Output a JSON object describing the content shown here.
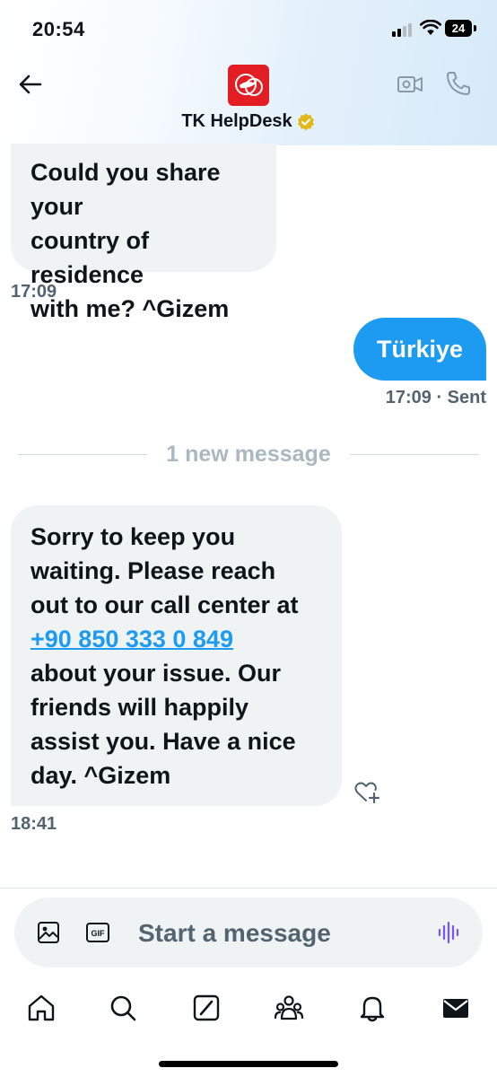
{
  "status_bar": {
    "time": "20:54",
    "battery": "24"
  },
  "header": {
    "title": "TK HelpDesk",
    "icons": {
      "back": "arrow-left-icon",
      "verified": "verified-badge-icon",
      "video": "video-call-icon",
      "phone": "phone-call-icon",
      "avatar": "turkish-airlines-logo"
    }
  },
  "messages": [
    {
      "direction": "incoming",
      "text": "Could you share your country of residence with me? ^Gizem",
      "lines": [
        "Could you share your",
        "country of residence",
        "with me? ^Gizem"
      ],
      "time": "17:09"
    },
    {
      "direction": "outgoing",
      "text": "Türkiye",
      "time": "17:09",
      "status": "· Sent"
    },
    {
      "direction": "incoming",
      "lines": [
        "Sorry to keep you",
        "waiting. Please reach",
        "out to our call center at",
        "+90 850 333 0 849",
        "about your issue. Our",
        "friends will happily",
        "assist you. Have a nice",
        "day. ^Gizem"
      ],
      "phone_link": "+90 850 333 0 849",
      "time": "18:41"
    }
  ],
  "divider": {
    "text": "1 new message"
  },
  "composer": {
    "placeholder": "Start a message",
    "value": "",
    "gif_label": "GIF",
    "icons": {
      "image": "image-icon",
      "gif": "gif-icon",
      "voice": "voice-message-icon"
    }
  },
  "tabbar": {
    "items": [
      "home-icon",
      "search-icon",
      "grok-icon",
      "communities-icon",
      "notifications-icon",
      "messages-icon"
    ]
  },
  "colors": {
    "accent": "#1d9bf0",
    "incoming_bubble": "#eff3f4",
    "muted_text": "#536471",
    "brand_red": "#e21d24",
    "verified_gold": "#e2b719",
    "voice_purple": "#7856ff"
  }
}
